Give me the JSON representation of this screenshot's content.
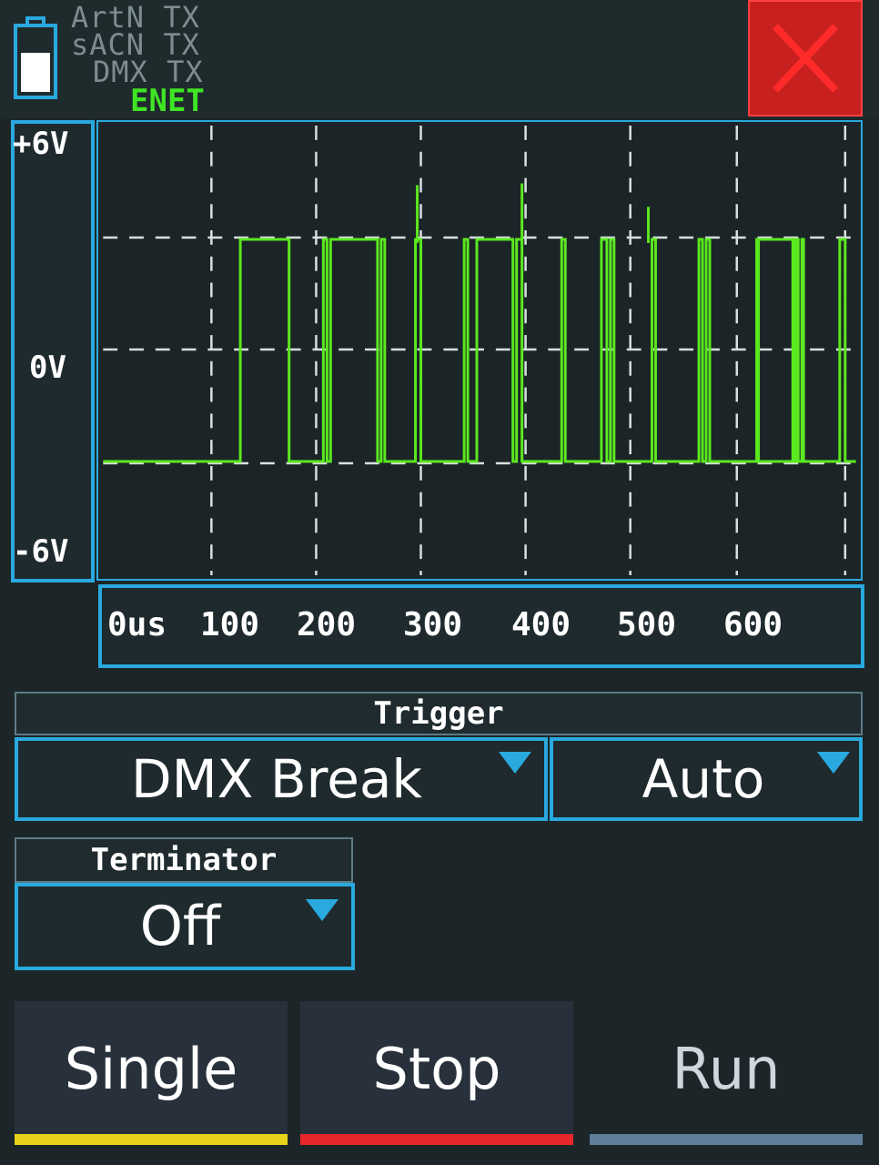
{
  "status": {
    "artnet_label": "ArtN",
    "artnet_value": "TX",
    "sacn_label": "sACN",
    "sacn_value": "TX",
    "dmx_label": "DMX",
    "dmx_value": "TX",
    "enet_label": "ENET"
  },
  "scope": {
    "voltage_labels": [
      "+6V",
      "0V",
      "-6V"
    ],
    "time_labels": [
      "0us",
      "100",
      "200",
      "300",
      "400",
      "500",
      "600"
    ],
    "trace_color": "#5be81f",
    "grid_color": "#d8e0e0",
    "axis_color": "#2aa9df"
  },
  "trigger": {
    "header": "Trigger",
    "source": "DMX Break",
    "mode": "Auto"
  },
  "terminator": {
    "header": "Terminator",
    "value": "Off"
  },
  "actions": {
    "single": {
      "label": "Single",
      "color": "#e8d21a"
    },
    "stop": {
      "label": "Stop",
      "color": "#e5262a"
    },
    "run": {
      "label": "Run",
      "color": "#5f7e9c"
    }
  },
  "colors": {
    "close_button": "#c8201e",
    "enet_active": "#3fe424",
    "battery": "#2aa9df"
  }
}
